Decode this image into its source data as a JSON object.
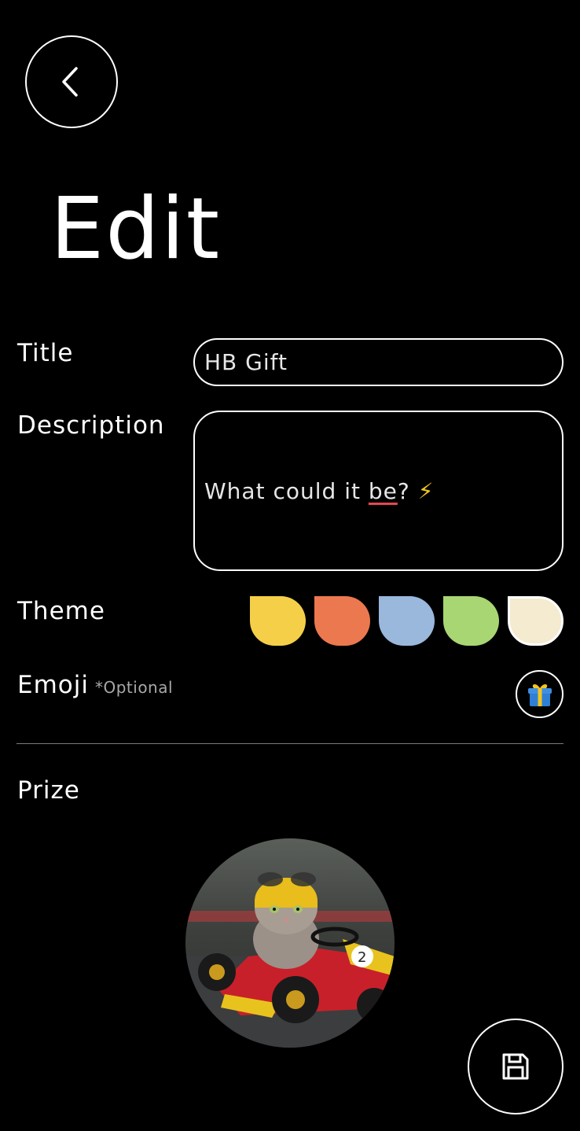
{
  "header": {
    "back_icon": "chevron-left-icon",
    "title": "Edit"
  },
  "form": {
    "title_label": "Title",
    "title_value": "HB Gift",
    "description_label": "Description",
    "description_value_part1": "What could it ",
    "description_value_misspelled": "be",
    "description_value_part2": "?",
    "description_value_emoji": "⚡",
    "theme_label": "Theme",
    "theme_colors": [
      "#f5cf47",
      "#ec784f",
      "#9ab7dc",
      "#a8d672",
      "#f4ebd0"
    ],
    "selected_theme_index": 4,
    "emoji_label": "Emoji",
    "emoji_optional": "*Optional",
    "emoji_icon": "gift-icon",
    "prize_label": "Prize",
    "prize_image": "cat-go-kart-photo"
  },
  "actions": {
    "save_icon": "floppy-disk-icon"
  }
}
